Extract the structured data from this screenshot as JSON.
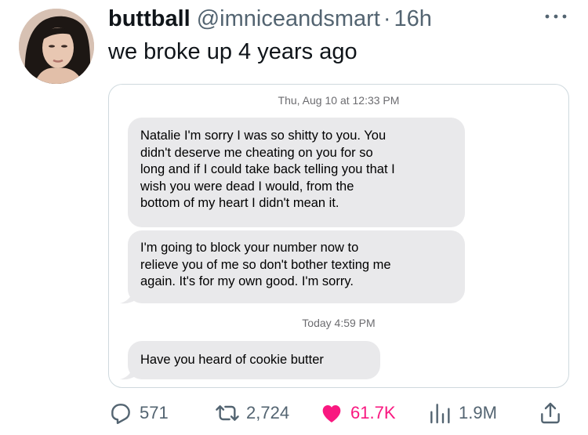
{
  "tweet": {
    "display_name": "buttball",
    "handle": "@imniceandsmart",
    "separator": "·",
    "time": "16h",
    "text": "we broke up 4 years ago"
  },
  "screenshot": {
    "timestamp_1": "Thu, Aug 10 at 12:33 PM",
    "messages": [
      {
        "text": "Natalie I'm sorry I was so shitty to you. You\ndidn't deserve me cheating on you for so\nlong and if I could take back telling you that I\nwish you were dead I would, from the\nbottom of my heart I didn't mean it."
      },
      {
        "text": "I'm going to block your number now to\nrelieve you of me so don't bother texting me\nagain. It's for my own good. I'm sorry."
      },
      {
        "text": "Have you heard of cookie butter"
      }
    ],
    "timestamp_2": "Today 4:59 PM"
  },
  "actions": {
    "reply_count": "571",
    "retweet_count": "2,724",
    "like_count": "61.7K",
    "view_count": "1.9M"
  },
  "icons": {
    "more": "more-options-icon",
    "reply": "reply-icon",
    "retweet": "retweet-icon",
    "like": "heart-icon",
    "views": "views-icon",
    "share": "share-icon"
  },
  "colors": {
    "like_active": "#f91880",
    "secondary_text": "#536471",
    "bubble": "#e9e9eb"
  }
}
